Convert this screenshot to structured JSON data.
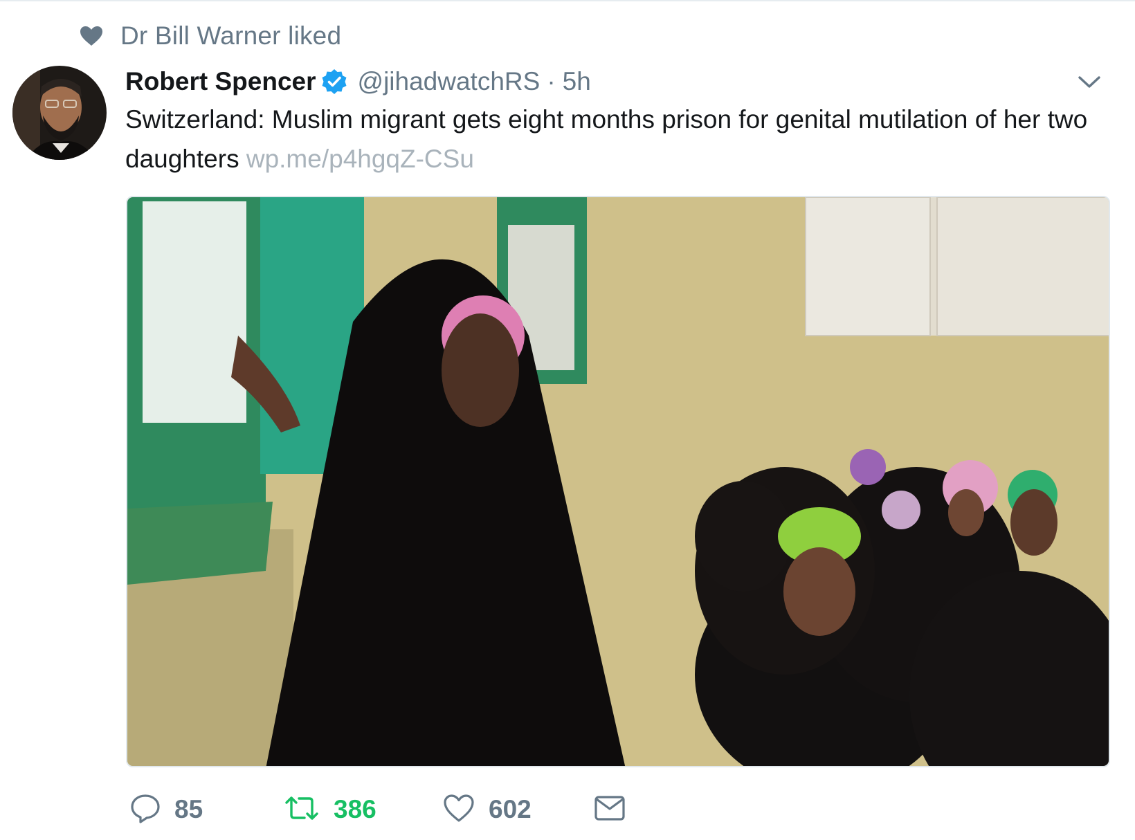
{
  "social_context": {
    "text": "Dr Bill Warner liked",
    "icon": "heart-icon"
  },
  "tweet": {
    "author_name": "Robert Spencer",
    "verified": true,
    "handle": "@jihadwatchRS",
    "separator": "·",
    "time": "5h",
    "text": "Switzerland: Muslim migrant gets eight months prison for genital mutilation of her two daughters",
    "link": "wp.me/p4hgqZ-CSu"
  },
  "actions": {
    "reply_count": "85",
    "retweet_count": "386",
    "like_count": "602"
  },
  "colors": {
    "name": "#14171a",
    "muted": "#657786",
    "link": "#a9b3bb",
    "verified": "#1da1f2",
    "retweet_active": "#17bf63"
  }
}
